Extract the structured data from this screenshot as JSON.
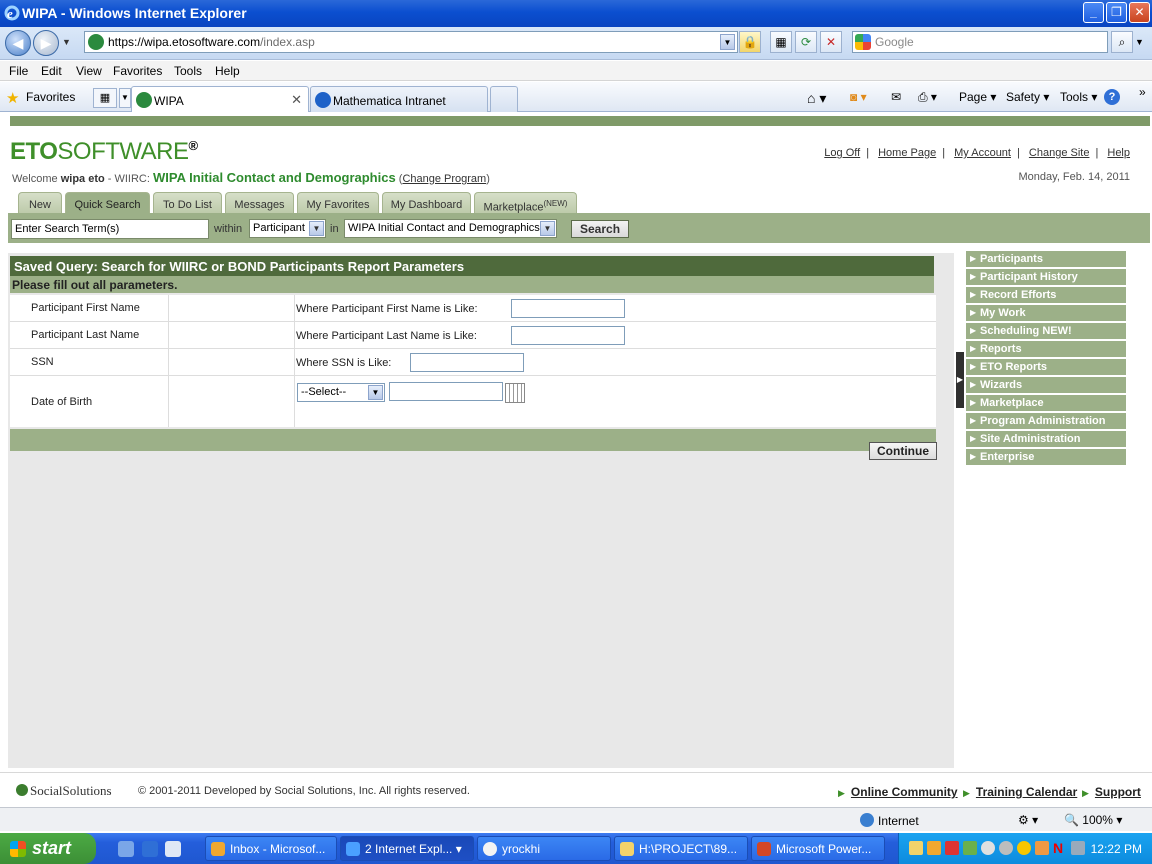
{
  "window": {
    "title": "WIPA - Windows Internet Explorer",
    "min_glyph": "_",
    "max_glyph": "❐",
    "close_glyph": "✕"
  },
  "address": {
    "url_main": "https://wipa.",
    "url_domain": "etosoftware.com",
    "url_path": "/index.asp",
    "search_placeholder": "Google"
  },
  "menu": [
    "File",
    "Edit",
    "View",
    "Favorites",
    "Tools",
    "Help"
  ],
  "favorites_bar": {
    "favorites_label": "Favorites",
    "tabs": [
      {
        "label": "WIPA"
      },
      {
        "label": "Mathematica Intranet"
      }
    ],
    "commands": [
      "Page ▾",
      "Safety ▾",
      "Tools ▾"
    ]
  },
  "header": {
    "brand_a": "ETO",
    "brand_b": "SOFTWARE",
    "brand_reg": "®",
    "welcome_prefix": "Welcome ",
    "user": "wipa eto",
    "site_prefix": " - WIIRC: ",
    "program": "WIPA Initial Contact and Demographics",
    "change_program": "Change Program",
    "links": [
      "Log Off",
      "Home Page",
      "My Account",
      "Change Site",
      "Help"
    ],
    "date": "Monday, Feb. 14, 2011"
  },
  "nav_tabs": [
    {
      "label": "New"
    },
    {
      "label": "Quick Search"
    },
    {
      "label": "To Do List"
    },
    {
      "label": "Messages"
    },
    {
      "label": "My Favorites"
    },
    {
      "label": "My Dashboard"
    },
    {
      "label": "Marketplace",
      "sup": "(NEW)"
    }
  ],
  "search": {
    "term_value": "Enter Search Term(s)",
    "within_label": "within",
    "entity": "Participant",
    "in_label": "in",
    "program": "WIPA Initial Contact and Demographics",
    "button": "Search"
  },
  "query": {
    "title": "Saved Query: Search for WIIRC or BOND Participants Report Parameters",
    "instruction": "Please fill out all parameters.",
    "params": [
      {
        "label": "Participant First Name",
        "condition": "Where Participant First Name is Like:"
      },
      {
        "label": "Participant Last Name",
        "condition": "Where Participant Last Name is Like:"
      },
      {
        "label": "SSN",
        "condition": "Where SSN is Like:"
      },
      {
        "label": "Date of Birth",
        "select": "--Select--"
      }
    ],
    "continue": "Continue"
  },
  "right_nav": [
    "Participants",
    "Participant History",
    "Record Efforts",
    "My Work",
    "Scheduling NEW!",
    "Reports",
    "ETO Reports",
    "Wizards",
    "Marketplace",
    "Program Administration",
    "Site Administration",
    "Enterprise"
  ],
  "footer": {
    "logo": "SocialSolutions",
    "copyright": "© 2001-2011 Developed by Social Solutions, Inc. All rights reserved.",
    "links": [
      "Online Community",
      "Training Calendar",
      "Support"
    ]
  },
  "status": {
    "zone": "Internet",
    "zoom": "100%"
  },
  "taskbar": {
    "start": "start",
    "tasks": [
      "Inbox - Microsof...",
      "2 Internet Expl...",
      "yrockhi",
      "H:\\PROJECT\\89...",
      "Microsoft Power..."
    ],
    "clock": "12:22 PM"
  }
}
